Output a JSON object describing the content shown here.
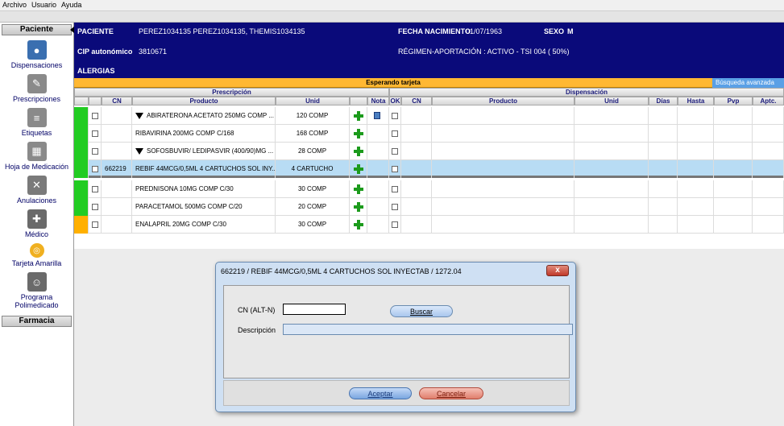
{
  "menu": [
    "Archivo",
    "Usuario",
    "Ayuda"
  ],
  "sidebar": {
    "header_top": "Paciente",
    "header_bottom": "Farmacia",
    "items": [
      {
        "label": "Dispensaciones",
        "icon": "pills-icon",
        "color": "#3a6fb0"
      },
      {
        "label": "Prescripciones",
        "icon": "notepad-icon",
        "color": "#8a8a8a"
      },
      {
        "label": "Etiquetas",
        "icon": "document-icon",
        "color": "#8a8a8a"
      },
      {
        "label": "Hoja de Medicación",
        "icon": "calendar-icon",
        "color": "#8a8a8a"
      },
      {
        "label": "Anulaciones",
        "icon": "cancel-pills-icon",
        "color": "#7a7a7a"
      },
      {
        "label": "Médico",
        "icon": "doctor-icon",
        "color": "#6a6a6a"
      },
      {
        "label": "Tarjeta Amarilla",
        "icon": "yellow-card-icon",
        "color": "#f0b020"
      },
      {
        "label": "Programa Polimedicado",
        "icon": "polymedicated-icon",
        "color": "#6a6a6a"
      }
    ]
  },
  "patient": {
    "paciente_label": "PACIENTE",
    "paciente_value": "PEREZ1034135 PEREZ1034135, THEMIS1034135",
    "fecha_label": "FECHA NACIMIENTO",
    "fecha_value": "01/07/1963",
    "sexo_label": "SEXO",
    "sexo_value": "M",
    "cip_label": "CIP autonómico",
    "cip_value": "3810671",
    "regimen": "RÉGIMEN-APORTACIÓN : ACTIVO - TSI 004 ( 50%)",
    "alergias_label": "ALERGIAS"
  },
  "status": {
    "text": "Esperando tarjeta",
    "search": "Búsqueda avanzada"
  },
  "table": {
    "group_prescripcion": "Prescripción",
    "group_dispensacion": "Dispensación",
    "headers": [
      "CN",
      "Producto",
      "Unid",
      "Nota",
      "OK",
      "CN",
      "Producto",
      "Unid",
      "Días",
      "Hasta",
      "Pvp",
      "Aptc."
    ],
    "rows": [
      {
        "status_color": "#22cc22",
        "cn": "",
        "triangle": true,
        "producto": "ABIRATERONA ACETATO 250MG COMP ...",
        "unid": "120 COMP",
        "icon": "plus-cycle",
        "nota": true,
        "selected": false
      },
      {
        "status_color": "#22cc22",
        "cn": "",
        "triangle": false,
        "producto": "RIBAVIRINA 200MG COMP C/168",
        "unid": "168 COMP",
        "icon": "plus-cycle",
        "nota": false,
        "selected": false
      },
      {
        "status_color": "#22cc22",
        "cn": "",
        "triangle": true,
        "producto": "SOFOSBUVIR/ LEDIPASVIR (400/90)MG ...",
        "unid": "28 COMP",
        "icon": "plus-cycle",
        "nota": false,
        "selected": false
      },
      {
        "status_color": "#22cc22",
        "cn": "662219",
        "triangle": false,
        "producto": "REBIF 44MCG/0,5ML 4 CARTUCHOS SOL INY...",
        "unid": "4 CARTUCHO",
        "icon": "plus-cycle",
        "nota": false,
        "selected": true
      },
      {
        "status_color": "#22cc22",
        "cn": "",
        "triangle": false,
        "producto": "PREDNISONA 10MG COMP C/30",
        "unid": "30 COMP",
        "icon": "plus",
        "nota": false,
        "selected": false
      },
      {
        "status_color": "#22cc22",
        "cn": "",
        "triangle": false,
        "producto": "PARACETAMOL 500MG COMP C/20",
        "unid": "20 COMP",
        "icon": "plus",
        "nota": false,
        "selected": false
      },
      {
        "status_color": "#ffb000",
        "cn": "",
        "triangle": false,
        "producto": "ENALAPRIL 20MG COMP C/30",
        "unid": "30 COMP",
        "icon": "plus",
        "nota": false,
        "selected": false
      }
    ]
  },
  "dialog": {
    "title": "662219 / REBIF 44MCG/0,5ML 4 CARTUCHOS SOL INYECTAB / 1272.04",
    "close": "x",
    "cn_label": "CN (ALT-N)",
    "cn_value": "",
    "buscar": "Buscar",
    "desc_label": "Descripción",
    "desc_value": "",
    "aceptar": "Aceptar",
    "cancelar": "Cancelar"
  }
}
